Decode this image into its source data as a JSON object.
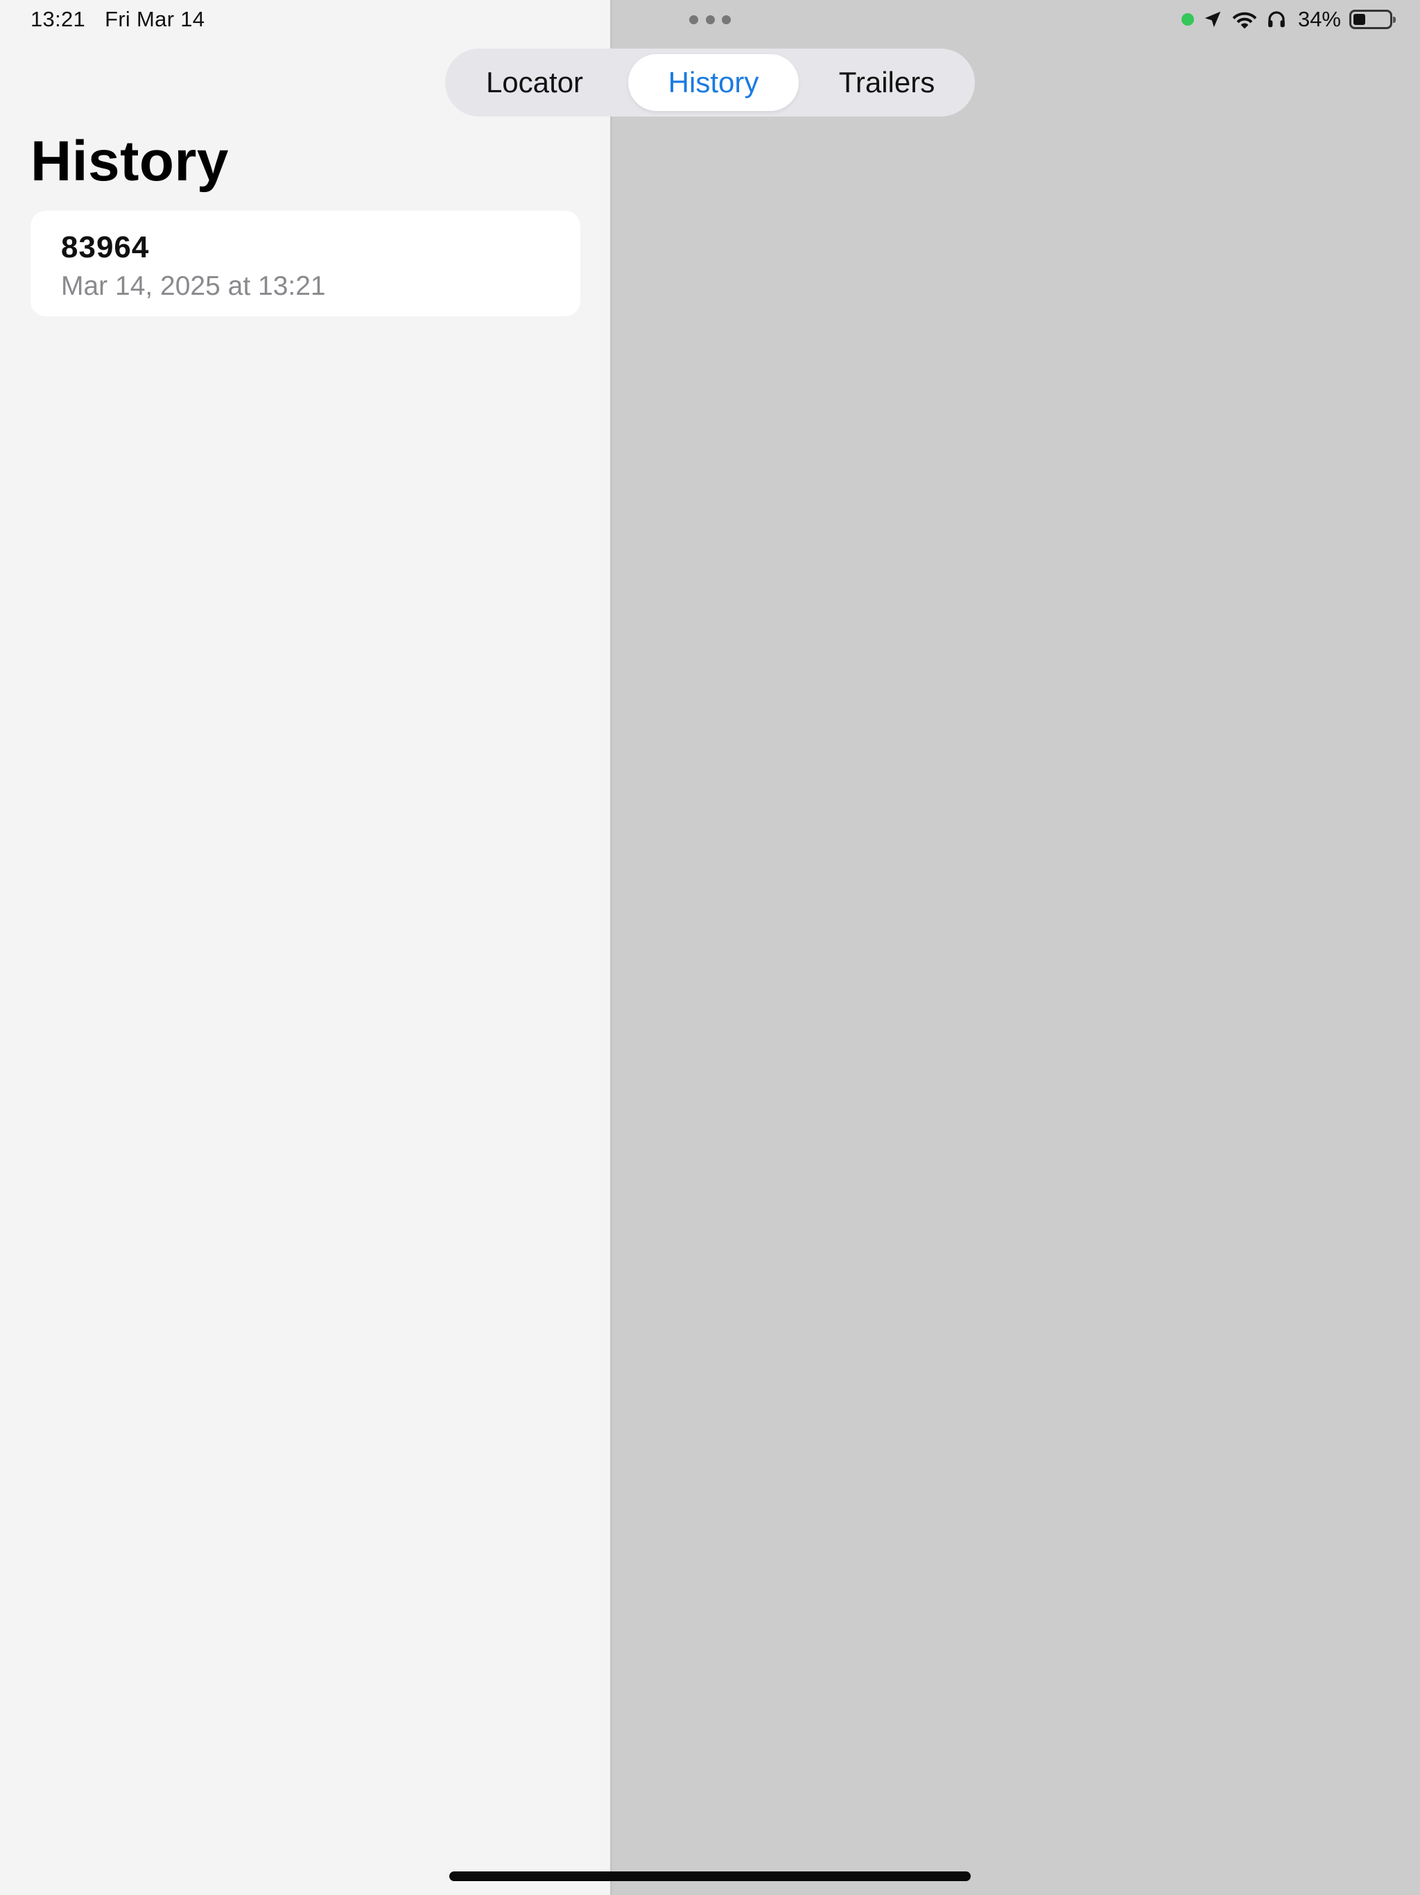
{
  "status_bar": {
    "time": "13:21",
    "date": "Fri Mar 14",
    "battery_percent": "34%",
    "battery_level": 0.34,
    "icons": [
      "recording-dot",
      "location-arrow-icon",
      "wifi-icon",
      "headphones-icon",
      "battery-icon"
    ],
    "recording_dot_color": "#34c759"
  },
  "tabs": [
    {
      "label": "Locator",
      "selected": false
    },
    {
      "label": "History",
      "selected": true
    },
    {
      "label": "Trailers",
      "selected": false
    }
  ],
  "accent_color": "#1b7be0",
  "sidebar": {
    "title": "History",
    "items": [
      {
        "title": "83964",
        "subtitle": "Mar 14, 2025 at 13:21"
      }
    ]
  }
}
